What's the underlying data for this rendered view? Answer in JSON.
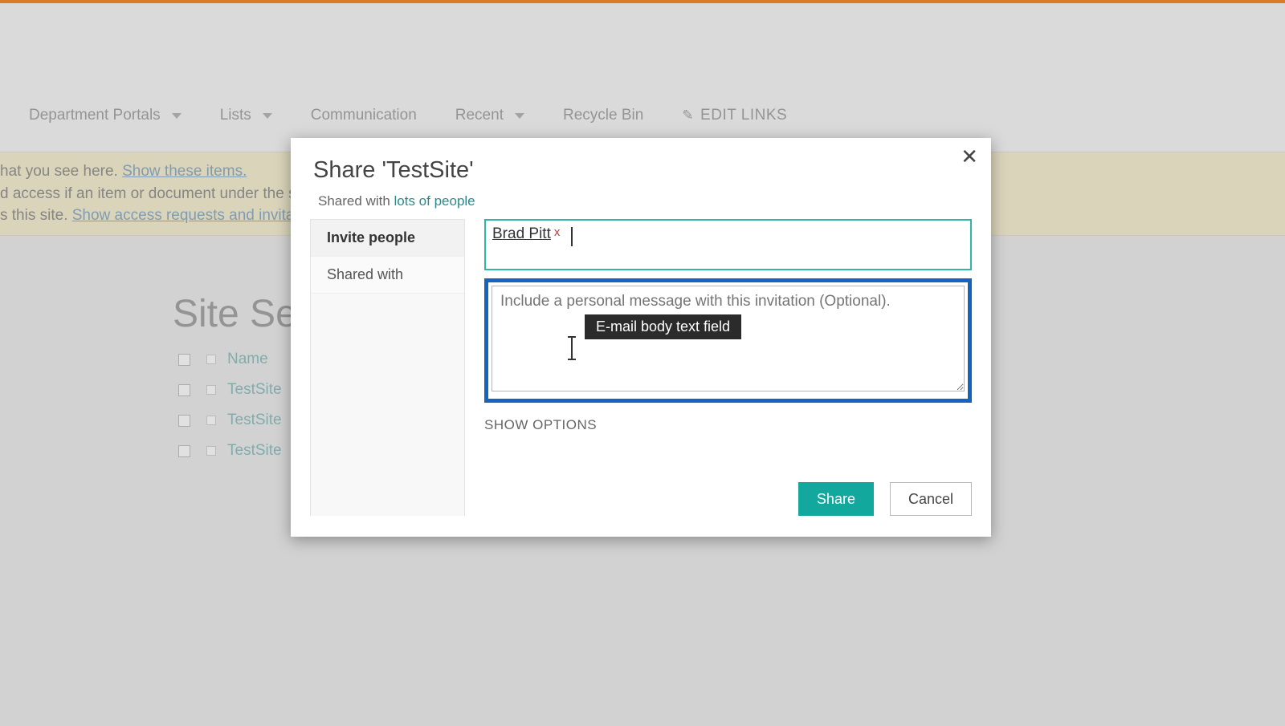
{
  "nav": {
    "items": [
      {
        "label": "Department Portals",
        "has_dropdown": true
      },
      {
        "label": "Lists",
        "has_dropdown": true
      },
      {
        "label": "Communication",
        "has_dropdown": false
      },
      {
        "label": "Recent",
        "has_dropdown": true
      },
      {
        "label": "Recycle Bin",
        "has_dropdown": false
      }
    ],
    "edit_links": "EDIT LINKS"
  },
  "notice": {
    "line1_prefix": "hat you see here.  ",
    "line1_link": "Show these items.",
    "line2": "d access if an item or document under the site",
    "line3_prefix": "s this site. ",
    "line3_link": "Show access requests and invitation"
  },
  "page": {
    "title": "Site Sett",
    "columns": {
      "name": "Name"
    },
    "rows": [
      {
        "name": "TestSite"
      },
      {
        "name": "TestSite"
      },
      {
        "name": "TestSite"
      }
    ]
  },
  "dialog": {
    "title": "Share 'TestSite'",
    "shared_prefix": "Shared with ",
    "shared_link": "lots of people",
    "tabs": {
      "invite": "Invite people",
      "shared_with": "Shared with"
    },
    "people_chip": "Brad Pitt",
    "people_remove": "x",
    "message_placeholder": "Include a personal message with this invitation (Optional).",
    "tooltip": "E-mail body text field",
    "show_options": "SHOW OPTIONS",
    "share_btn": "Share",
    "cancel_btn": "Cancel"
  }
}
